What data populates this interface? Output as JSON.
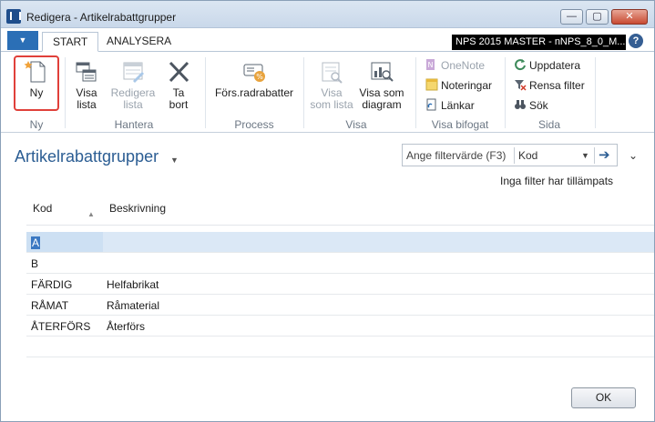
{
  "window": {
    "title": "Redigera - Artikelrabattgrupper",
    "min_glyph": "—",
    "max_glyph": "▢",
    "close_glyph": "✕"
  },
  "tabs": {
    "menu_glyph": "▼",
    "start": "START",
    "analysera": "ANALYSERA",
    "company": "NPS 2015 MASTER - nNPS_8_0_M...",
    "help": "?"
  },
  "ribbon": {
    "ny": "Ny",
    "visa_lista": [
      "Visa",
      "lista"
    ],
    "redigera_lista": [
      "Redigera",
      "lista"
    ],
    "ta_bort": [
      "Ta",
      "bort"
    ],
    "fors_radrabatter": "Förs.radrabatter",
    "visa_som_lista": [
      "Visa",
      "som lista"
    ],
    "visa_som_diagram": [
      "Visa som",
      "diagram"
    ],
    "onenote": "OneNote",
    "noteringar": "Noteringar",
    "lankar": "Länkar",
    "uppdatera": "Uppdatera",
    "rensa_filter": "Rensa filter",
    "sok": "Sök",
    "groups": {
      "ny": "Ny",
      "hantera": "Hantera",
      "process": "Process",
      "visa": "Visa",
      "visa_bifogat": "Visa bifogat",
      "sida": "Sida"
    }
  },
  "page": {
    "title": "Artikelrabattgrupper",
    "title_caret": "▼",
    "filter_placeholder": "Ange filtervärde (F3)",
    "filter_field": "Kod",
    "filter_caret": "▼",
    "filter_go": "➔",
    "collapse": "⌄",
    "filter_status": "Inga filter har tillämpats"
  },
  "table": {
    "columns": [
      "Kod",
      "Beskrivning"
    ],
    "sort_indicator": "▲",
    "rows": [
      {
        "kod": "A",
        "beskrivning": ""
      },
      {
        "kod": "B",
        "beskrivning": ""
      },
      {
        "kod": "FÄRDIG",
        "beskrivning": "Helfabrikat"
      },
      {
        "kod": "RÅMAT",
        "beskrivning": "Råmaterial"
      },
      {
        "kod": "ÅTERFÖRS",
        "beskrivning": "Återförs"
      }
    ]
  },
  "footer": {
    "ok": "OK"
  },
  "colors": {
    "accent": "#2b6fb6",
    "title_blue": "#2b5d93",
    "selected_row": "#cde0f3",
    "highlight_box": "#e0403a"
  }
}
